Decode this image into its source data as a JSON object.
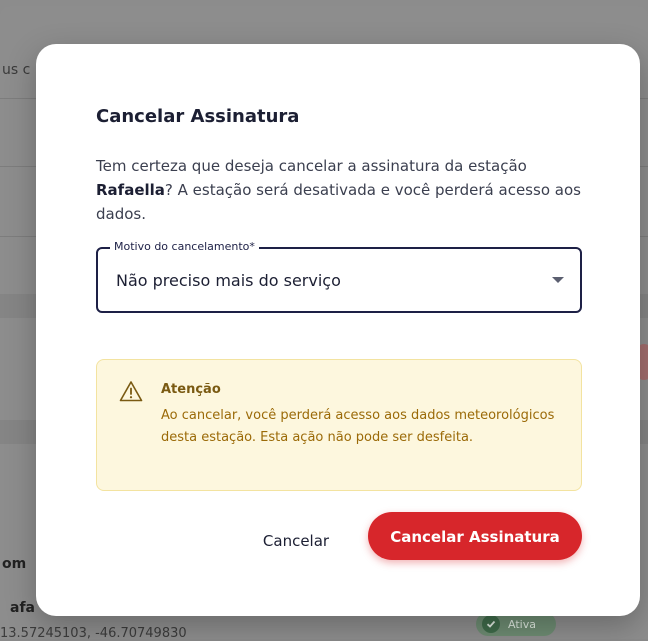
{
  "background": {
    "top_fragment": "us c",
    "bottom_fragment_1": "om",
    "bottom_fragment_2": "afa",
    "coordinates": "13.57245103, -46.70749830",
    "status_badge": "Ativa"
  },
  "modal": {
    "title": "Cancelar Assinatura",
    "description_prefix": "Tem certeza que deseja cancelar a assinatura da estação ",
    "station_name": "Rafaella",
    "description_suffix": "? A estação será desativada e você perderá acesso aos dados.",
    "reason_field": {
      "label": "Motivo do cancelamento*",
      "value": "Não preciso mais do serviço"
    },
    "warning": {
      "title": "Atenção",
      "text": "Ao cancelar, você perderá acesso aos dados meteorológicos desta estação. Esta ação não pode ser desfeita."
    },
    "cancel_label": "Cancelar",
    "confirm_label": "Cancelar Assinatura"
  },
  "colors": {
    "accent_danger": "#d7262b",
    "warning_bg": "#fdf7de",
    "warning_text": "#9b6a08",
    "field_border": "#1d2046"
  },
  "icons": {
    "warning": "warning-triangle-icon",
    "dropdown": "caret-down-icon",
    "status": "check-circle-icon"
  }
}
